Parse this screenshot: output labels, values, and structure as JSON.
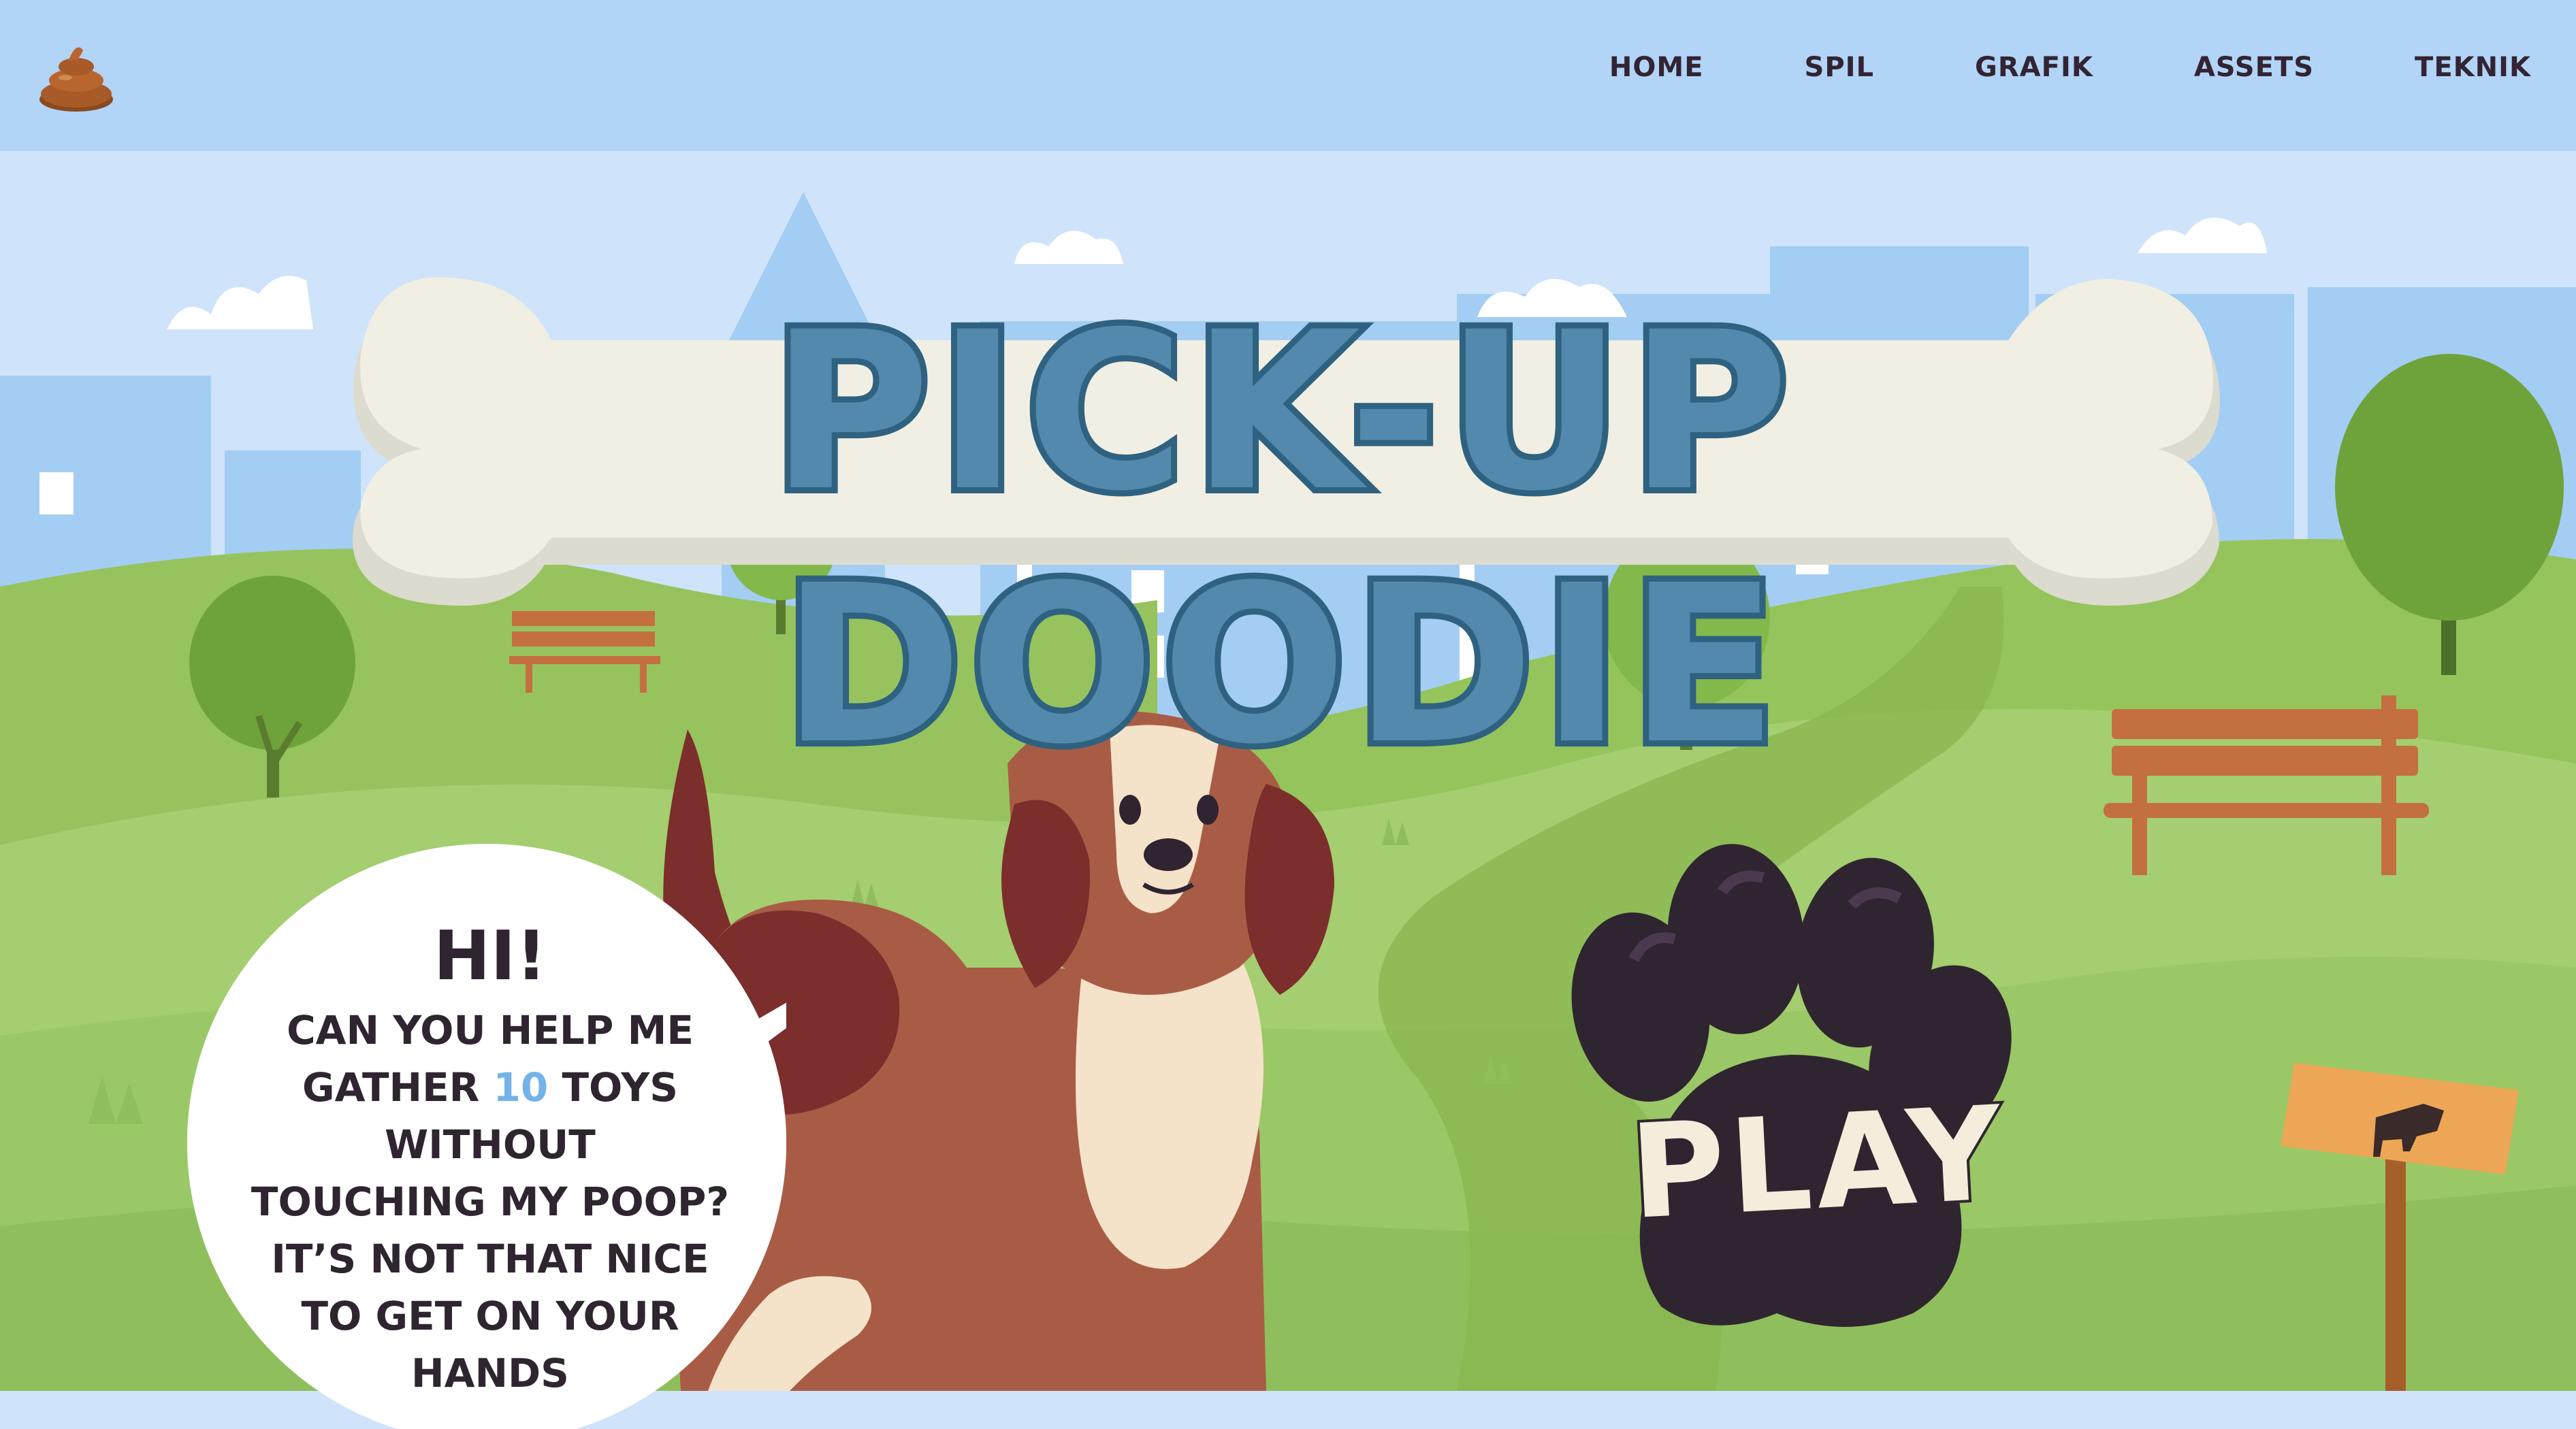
{
  "header": {
    "logo_icon": "poop-icon",
    "nav": [
      "HOME",
      "SPIL",
      "GRAFIK",
      "ASSETS",
      "TEKNIK"
    ]
  },
  "hero": {
    "title": "PICK-UP DOODIE"
  },
  "speech_bubble": {
    "greeting": "HI!",
    "line_1": "CAN YOU HELP ME",
    "line_2_before": "GATHER ",
    "line_2_number": "10",
    "line_2_after": " TOYS WITHOUT",
    "line_3": "TOUCHING MY POOP?",
    "line_4": "IT’S NOT THAT NICE",
    "line_5": "TO GET ON YOUR",
    "line_6": "HANDS"
  },
  "play_button": {
    "label": "PLAY",
    "icon": "paw-icon"
  },
  "colors": {
    "topbar": "#b1d4f7",
    "sky": "#cfe4fa",
    "grass": "#a2c86e",
    "title_fill": "#5289ad",
    "bubble_accent": "#74b3e8",
    "paw": "#2f2530"
  }
}
